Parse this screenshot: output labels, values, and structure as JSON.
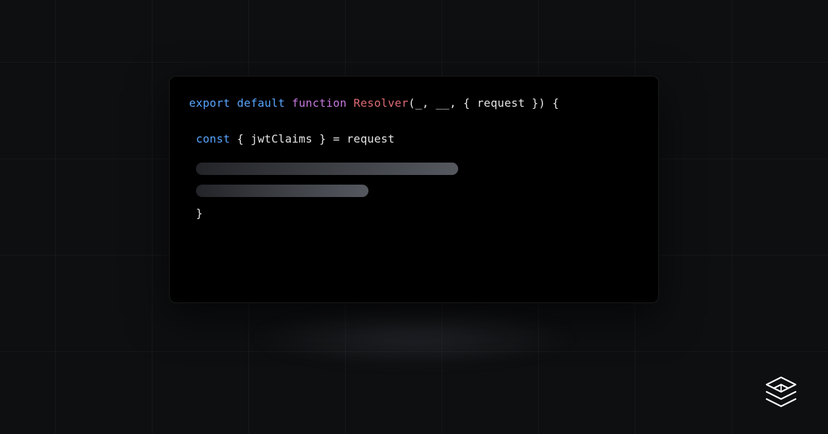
{
  "code": {
    "line1": {
      "export": "export",
      "default": "default",
      "function": "function",
      "fn_name": "Resolver",
      "params": "(_, __, { request }) {"
    },
    "line2": {
      "const": "const",
      "destructure": " { jwtClaims } = request"
    },
    "close_brace": "}"
  }
}
